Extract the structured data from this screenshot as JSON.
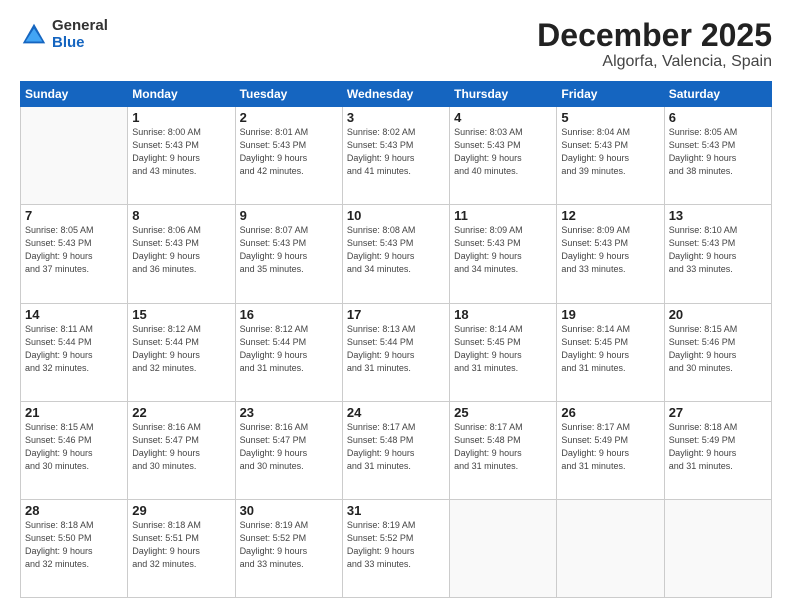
{
  "logo": {
    "general": "General",
    "blue": "Blue"
  },
  "header": {
    "title": "December 2025",
    "subtitle": "Algorfa, Valencia, Spain"
  },
  "weekdays": [
    "Sunday",
    "Monday",
    "Tuesday",
    "Wednesday",
    "Thursday",
    "Friday",
    "Saturday"
  ],
  "weeks": [
    [
      {
        "day": "",
        "info": ""
      },
      {
        "day": "1",
        "info": "Sunrise: 8:00 AM\nSunset: 5:43 PM\nDaylight: 9 hours\nand 43 minutes."
      },
      {
        "day": "2",
        "info": "Sunrise: 8:01 AM\nSunset: 5:43 PM\nDaylight: 9 hours\nand 42 minutes."
      },
      {
        "day": "3",
        "info": "Sunrise: 8:02 AM\nSunset: 5:43 PM\nDaylight: 9 hours\nand 41 minutes."
      },
      {
        "day": "4",
        "info": "Sunrise: 8:03 AM\nSunset: 5:43 PM\nDaylight: 9 hours\nand 40 minutes."
      },
      {
        "day": "5",
        "info": "Sunrise: 8:04 AM\nSunset: 5:43 PM\nDaylight: 9 hours\nand 39 minutes."
      },
      {
        "day": "6",
        "info": "Sunrise: 8:05 AM\nSunset: 5:43 PM\nDaylight: 9 hours\nand 38 minutes."
      }
    ],
    [
      {
        "day": "7",
        "info": "Sunrise: 8:05 AM\nSunset: 5:43 PM\nDaylight: 9 hours\nand 37 minutes."
      },
      {
        "day": "8",
        "info": "Sunrise: 8:06 AM\nSunset: 5:43 PM\nDaylight: 9 hours\nand 36 minutes."
      },
      {
        "day": "9",
        "info": "Sunrise: 8:07 AM\nSunset: 5:43 PM\nDaylight: 9 hours\nand 35 minutes."
      },
      {
        "day": "10",
        "info": "Sunrise: 8:08 AM\nSunset: 5:43 PM\nDaylight: 9 hours\nand 34 minutes."
      },
      {
        "day": "11",
        "info": "Sunrise: 8:09 AM\nSunset: 5:43 PM\nDaylight: 9 hours\nand 34 minutes."
      },
      {
        "day": "12",
        "info": "Sunrise: 8:09 AM\nSunset: 5:43 PM\nDaylight: 9 hours\nand 33 minutes."
      },
      {
        "day": "13",
        "info": "Sunrise: 8:10 AM\nSunset: 5:43 PM\nDaylight: 9 hours\nand 33 minutes."
      }
    ],
    [
      {
        "day": "14",
        "info": "Sunrise: 8:11 AM\nSunset: 5:44 PM\nDaylight: 9 hours\nand 32 minutes."
      },
      {
        "day": "15",
        "info": "Sunrise: 8:12 AM\nSunset: 5:44 PM\nDaylight: 9 hours\nand 32 minutes."
      },
      {
        "day": "16",
        "info": "Sunrise: 8:12 AM\nSunset: 5:44 PM\nDaylight: 9 hours\nand 31 minutes."
      },
      {
        "day": "17",
        "info": "Sunrise: 8:13 AM\nSunset: 5:44 PM\nDaylight: 9 hours\nand 31 minutes."
      },
      {
        "day": "18",
        "info": "Sunrise: 8:14 AM\nSunset: 5:45 PM\nDaylight: 9 hours\nand 31 minutes."
      },
      {
        "day": "19",
        "info": "Sunrise: 8:14 AM\nSunset: 5:45 PM\nDaylight: 9 hours\nand 31 minutes."
      },
      {
        "day": "20",
        "info": "Sunrise: 8:15 AM\nSunset: 5:46 PM\nDaylight: 9 hours\nand 30 minutes."
      }
    ],
    [
      {
        "day": "21",
        "info": "Sunrise: 8:15 AM\nSunset: 5:46 PM\nDaylight: 9 hours\nand 30 minutes."
      },
      {
        "day": "22",
        "info": "Sunrise: 8:16 AM\nSunset: 5:47 PM\nDaylight: 9 hours\nand 30 minutes."
      },
      {
        "day": "23",
        "info": "Sunrise: 8:16 AM\nSunset: 5:47 PM\nDaylight: 9 hours\nand 30 minutes."
      },
      {
        "day": "24",
        "info": "Sunrise: 8:17 AM\nSunset: 5:48 PM\nDaylight: 9 hours\nand 31 minutes."
      },
      {
        "day": "25",
        "info": "Sunrise: 8:17 AM\nSunset: 5:48 PM\nDaylight: 9 hours\nand 31 minutes."
      },
      {
        "day": "26",
        "info": "Sunrise: 8:17 AM\nSunset: 5:49 PM\nDaylight: 9 hours\nand 31 minutes."
      },
      {
        "day": "27",
        "info": "Sunrise: 8:18 AM\nSunset: 5:49 PM\nDaylight: 9 hours\nand 31 minutes."
      }
    ],
    [
      {
        "day": "28",
        "info": "Sunrise: 8:18 AM\nSunset: 5:50 PM\nDaylight: 9 hours\nand 32 minutes."
      },
      {
        "day": "29",
        "info": "Sunrise: 8:18 AM\nSunset: 5:51 PM\nDaylight: 9 hours\nand 32 minutes."
      },
      {
        "day": "30",
        "info": "Sunrise: 8:19 AM\nSunset: 5:52 PM\nDaylight: 9 hours\nand 33 minutes."
      },
      {
        "day": "31",
        "info": "Sunrise: 8:19 AM\nSunset: 5:52 PM\nDaylight: 9 hours\nand 33 minutes."
      },
      {
        "day": "",
        "info": ""
      },
      {
        "day": "",
        "info": ""
      },
      {
        "day": "",
        "info": ""
      }
    ]
  ]
}
